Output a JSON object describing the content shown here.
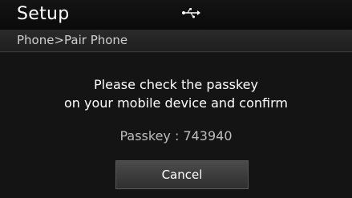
{
  "header": {
    "title": "Setup",
    "status_icon": "usb-icon"
  },
  "breadcrumb": {
    "text": "Phone>Pair Phone"
  },
  "dialog": {
    "message_line1": "Please check the passkey",
    "message_line2": "on your mobile device and confirm",
    "passkey_text": "Passkey : 743940",
    "cancel_label": "Cancel"
  },
  "colors": {
    "background": "#1a1a1a",
    "text": "#ffffff",
    "button": "#3c3c3c"
  }
}
